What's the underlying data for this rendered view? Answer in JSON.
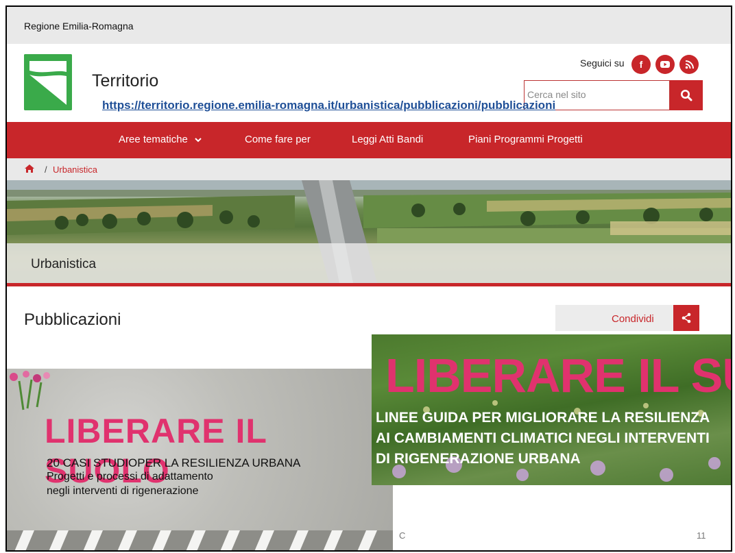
{
  "region_bar": {
    "label": "Regione Emilia-Romagna"
  },
  "header": {
    "site_title": "Territorio",
    "follow_label": "Seguici su",
    "search_placeholder": "Cerca nel sito",
    "url_overlay": "https://territorio.regione.emilia-romagna.it/urbanistica/pubblicazioni/pubblicazioni",
    "social_icons": [
      "facebook-icon",
      "youtube-icon",
      "rss-icon"
    ]
  },
  "nav": {
    "items": [
      {
        "label": "Aree tematiche"
      },
      {
        "label": "Come fare per"
      },
      {
        "label": "Leggi Atti Bandi"
      },
      {
        "label": "Piani Programmi Progetti"
      }
    ]
  },
  "breadcrumb": {
    "separator": "/",
    "current": "Urbanistica"
  },
  "banner": {
    "title": "Urbanistica"
  },
  "page": {
    "title": "Pubblicazioni",
    "share_label": "Condividi"
  },
  "cover_left": {
    "title": "LIBERARE IL SUOLO",
    "line1": "20 CASI STUDIOPER LA RESILIENZA URBANA",
    "line2": "Progetti e processi di adattamento",
    "line3": "negli interventi di rigenerazione"
  },
  "cover_right": {
    "title": "LIBERARE IL SUOLO",
    "line1": "LINEE GUIDA PER MIGLIORARE LA RESILIENZA",
    "line2": "AI CAMBIAMENTI CLIMATICI NEGLI INTERVENTI",
    "line3": "DI RIGENERAZIONE URBANA"
  },
  "footer": {
    "c": "C",
    "page_number": "11"
  },
  "colors": {
    "accent": "#c8262a",
    "logo_green": "#3aaa4a",
    "cover_pink": "#e0326e",
    "url_blue": "#1f4f97"
  }
}
